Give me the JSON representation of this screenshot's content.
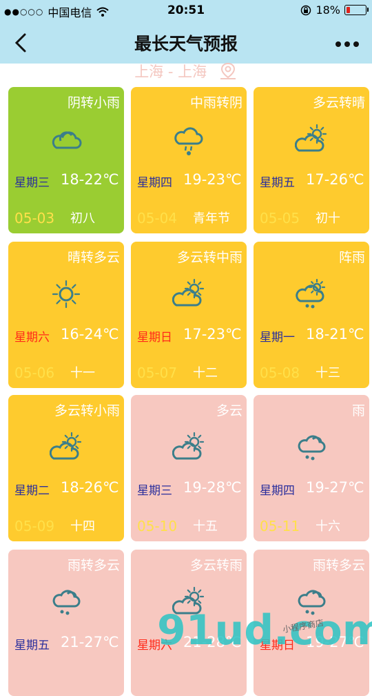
{
  "status_bar": {
    "signal_dots": "●●○○○",
    "carrier": "中国电信",
    "time": "20:51",
    "battery_text": "18%",
    "battery_level": 0.18
  },
  "header": {
    "title": "最长天气预报"
  },
  "location": {
    "text": "上海 - 上海"
  },
  "colors": {
    "green": "#9acd32",
    "yellow": "#fecb2e",
    "pink": "#f7c8c0",
    "icon": "#3b7e8a",
    "weekday_blue": "#2b2f9c",
    "weekday_red": "#ff2a1a",
    "date_yellow": "#ffe04a"
  },
  "forecast": [
    {
      "desc": "阴转小雨",
      "weekday": "星期三",
      "temp": "18-22℃",
      "date": "05-03",
      "lunar": "初八",
      "icon": "cloud-icon",
      "bg": "green",
      "wd_color": "blue"
    },
    {
      "desc": "中雨转阴",
      "weekday": "星期四",
      "temp": "19-23℃",
      "date": "05-04",
      "lunar": "青年节",
      "icon": "rain-icon",
      "bg": "yellow",
      "wd_color": "blue"
    },
    {
      "desc": "多云转晴",
      "weekday": "星期五",
      "temp": "17-26℃",
      "date": "05-05",
      "lunar": "初十",
      "icon": "partly-cloudy-icon",
      "bg": "yellow",
      "wd_color": "blue"
    },
    {
      "desc": "晴转多云",
      "weekday": "星期六",
      "temp": "16-24℃",
      "date": "05-06",
      "lunar": "十一",
      "icon": "sun-icon",
      "bg": "yellow",
      "wd_color": "red"
    },
    {
      "desc": "多云转中雨",
      "weekday": "星期日",
      "temp": "17-23℃",
      "date": "05-07",
      "lunar": "十二",
      "icon": "partly-cloudy-icon",
      "bg": "yellow",
      "wd_color": "red"
    },
    {
      "desc": "阵雨",
      "weekday": "星期一",
      "temp": "18-21℃",
      "date": "05-08",
      "lunar": "十三",
      "icon": "shower-icon",
      "bg": "yellow",
      "wd_color": "blue"
    },
    {
      "desc": "多云转小雨",
      "weekday": "星期二",
      "temp": "18-26℃",
      "date": "05-09",
      "lunar": "十四",
      "icon": "partly-cloudy-icon",
      "bg": "yellow",
      "wd_color": "blue"
    },
    {
      "desc": "多云",
      "weekday": "星期三",
      "temp": "19-28℃",
      "date": "05-10",
      "lunar": "十五",
      "icon": "partly-cloudy-icon",
      "bg": "pink",
      "wd_color": "blue"
    },
    {
      "desc": "雨",
      "weekday": "星期四",
      "temp": "19-27℃",
      "date": "05-11",
      "lunar": "十六",
      "icon": "rain-cloud-icon",
      "bg": "pink",
      "wd_color": "blue"
    },
    {
      "desc": "雨转多云",
      "weekday": "星期五",
      "temp": "21-27℃",
      "date": "",
      "lunar": "",
      "icon": "rain-cloud-icon",
      "bg": "pink",
      "wd_color": "blue"
    },
    {
      "desc": "多云转雨",
      "weekday": "星期六",
      "temp": "21-28℃",
      "date": "",
      "lunar": "",
      "icon": "partly-cloudy-icon",
      "bg": "pink",
      "wd_color": "red"
    },
    {
      "desc": "雨转多云",
      "weekday": "星期日",
      "temp": "19-27℃",
      "date": "",
      "lunar": "",
      "icon": "rain-cloud-icon",
      "bg": "pink",
      "wd_color": "red"
    }
  ],
  "watermark": {
    "text": "91ud.com",
    "sub": "小程序商店"
  }
}
